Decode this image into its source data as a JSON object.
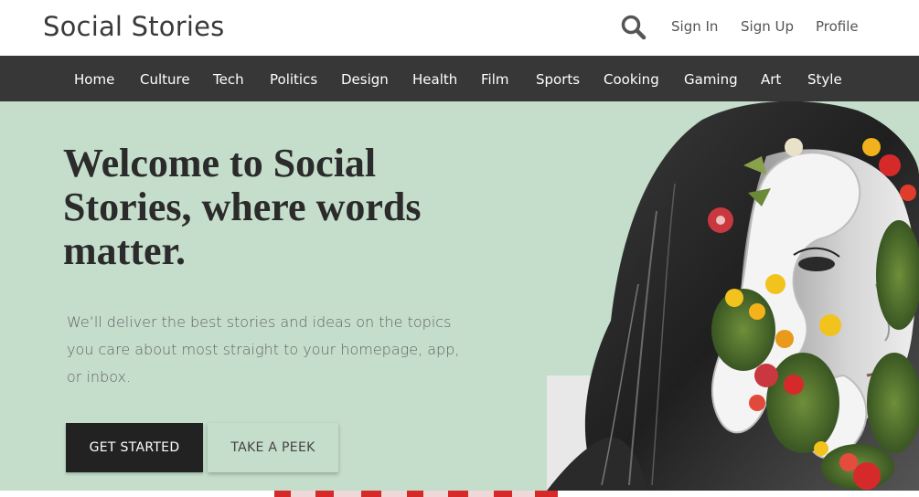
{
  "header": {
    "brand": "Social Stories",
    "links": {
      "signin": "Sign In",
      "signup": "Sign Up",
      "profile": "Profile"
    },
    "search_icon": "search-icon"
  },
  "nav": {
    "items": [
      "Home",
      "Culture",
      "Tech",
      "Politics",
      "Design",
      "Health",
      "Film",
      "Sports",
      "Cooking",
      "Gaming",
      "Art",
      "Style"
    ]
  },
  "hero": {
    "title": "Welcome to Social Stories, where words matter.",
    "subtitle": "We’ll deliver the best stories and ideas on the topics you care about most straight to your homepage, app, or inbox.",
    "primary_button": "GET STARTED",
    "secondary_button": "TAKE A PEEK"
  },
  "colors": {
    "nav_bg": "#373737",
    "hero_bg": "#c5ddcb",
    "primary_btn": "#222222",
    "accent_red": "#d62a2a"
  }
}
